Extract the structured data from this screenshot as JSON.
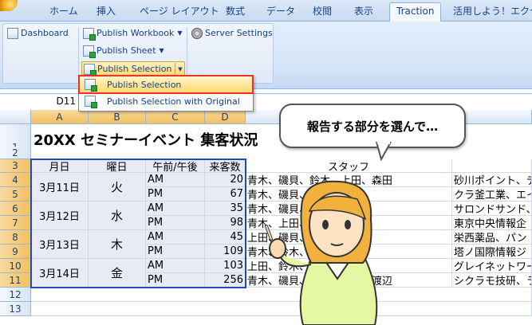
{
  "ribbon_tabs": [
    "ホーム",
    "挿入",
    "ページ レイアウト",
    "数式",
    "データ",
    "校閲",
    "表示",
    "Traction",
    "活用しよう！エクセル"
  ],
  "active_tab": "Traction",
  "ribbon": {
    "dashboard": "Dashboard",
    "publish_workbook": "Publish Workbook",
    "publish_sheet": "Publish Sheet",
    "publish_selection": "Publish Selection",
    "server_settings": "Server Settings"
  },
  "dropdown": {
    "item1": "Publish Selection",
    "item2": "Publish Selection with Original"
  },
  "name_box": "D11",
  "columns": [
    "A",
    "B",
    "C",
    "D"
  ],
  "rows": [
    "1",
    "2",
    "3",
    "4",
    "5",
    "6",
    "7",
    "8",
    "9",
    "10",
    "11",
    "12",
    "13"
  ],
  "sheet_title": "20XX セミナーイベント 集客状況",
  "headers": {
    "date": "月日",
    "weekday": "曜日",
    "ampm": "午前/午後",
    "count": "来客数",
    "staff": "スタッフ"
  },
  "days": [
    {
      "date": "3月11日",
      "weekday": "火"
    },
    {
      "date": "3月12日",
      "weekday": "水"
    },
    {
      "date": "3月13日",
      "weekday": "木"
    },
    {
      "date": "3月14日",
      "weekday": "金"
    }
  ],
  "data_rows": [
    {
      "ampm": "AM",
      "count": "20",
      "staff": "青木、磯貝、鈴木、上田、森田",
      "company": "砂川ポイント、デ"
    },
    {
      "ampm": "PM",
      "count": "67",
      "staff": "青木、磯貝、鈴木、山本",
      "company": "クラ釜工業、エイ"
    },
    {
      "ampm": "AM",
      "count": "35",
      "staff": "青木、磯貝、森田",
      "company": "サロンドサンド、"
    },
    {
      "ampm": "PM",
      "count": "98",
      "staff": "青木、上田、森田、山本",
      "company": "東京中央情報企"
    },
    {
      "ampm": "AM",
      "count": "45",
      "staff": "上田、磯貝、山本、渡辺",
      "company": "栄西薬品、パン"
    },
    {
      "ampm": "PM",
      "count": "109",
      "staff": "青木、鈴木、山本、渡辺",
      "company": "塔ノ国際情報ジ"
    },
    {
      "ampm": "AM",
      "count": "103",
      "staff": "上田、鈴木、山本、渡辺",
      "company": "グレイネットワー"
    },
    {
      "ampm": "PM",
      "count": "256",
      "staff": "青木、磯貝、羽田、山本、渡辺",
      "company": "シクラモ技研、ラ"
    }
  ],
  "callout_text": "報告する部分を選んで…"
}
